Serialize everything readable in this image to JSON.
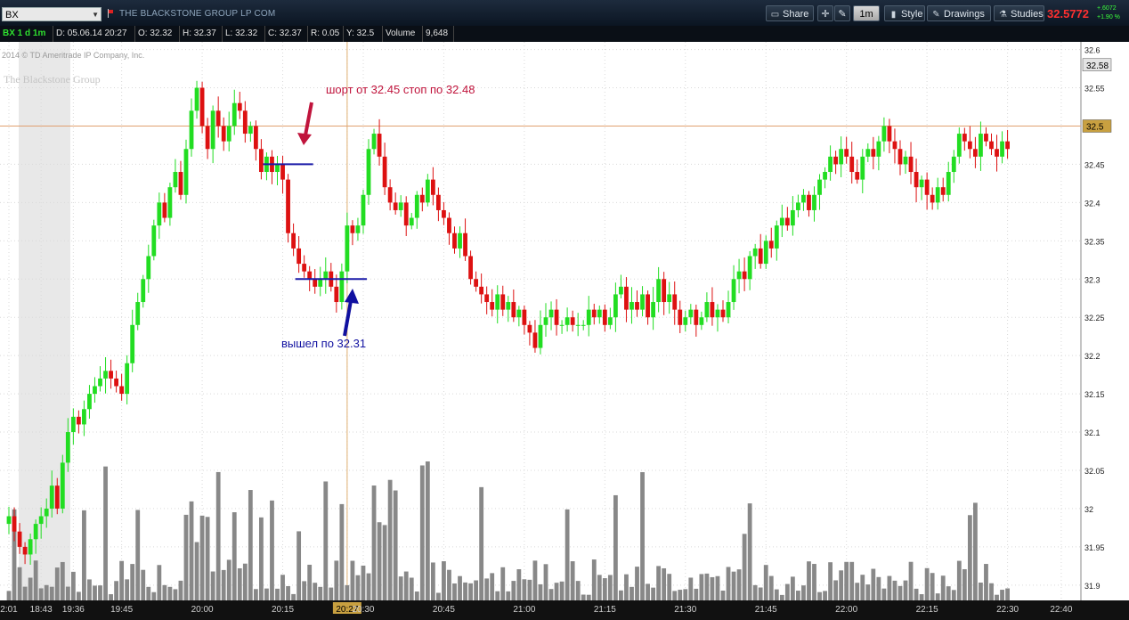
{
  "toolbar": {
    "symbol": "BX",
    "company": "THE BLACKSTONE GROUP LP COM",
    "share_label": "Share",
    "timeframe_label": "1m",
    "style_label": "Style",
    "drawings_label": "Drawings",
    "studies_label": "Studies",
    "last_price": "32.5772",
    "change_abs": "+.6072",
    "change_pct": "+1.90 %",
    "corner_button": "↗"
  },
  "infobar": {
    "title": "BX 1 d 1m",
    "date": "D: 05.06.14 20:27",
    "open": "O: 32.32",
    "high": "H: 32.37",
    "low": "L: 32.32",
    "close": "C: 32.37",
    "range": "R: 0.05",
    "y": "Y: 32.5",
    "volume_label": "Volume",
    "volume_value": "9,648"
  },
  "watermark": {
    "copyright": "2014 © TD Ameritrade IP Company, Inc.",
    "company": "The Blackstone Group"
  },
  "annotations": {
    "short_note": "шорт от 32.45 стоп по 32.48",
    "exit_note": "вышел по 32.31"
  },
  "colors": {
    "up": "#22dd22",
    "down": "#dd1111",
    "volume": "#888888",
    "annotation_red": "#c0143c",
    "annotation_blue": "#1010a0",
    "priceline": "#e0a070"
  },
  "chart_data": {
    "type": "candlestick",
    "symbol": "BX",
    "interval": "1m",
    "ylim": [
      31.88,
      32.61
    ],
    "y_ticks": [
      32.6,
      32.55,
      32.5,
      32.45,
      32.4,
      32.35,
      32.3,
      32.25,
      32.2,
      32.15,
      32.1,
      32.05,
      32.0,
      31.95,
      31.9
    ],
    "x_ticks": [
      {
        "label": "2:01",
        "index": 0
      },
      {
        "label": "18:43",
        "index": 6
      },
      {
        "label": "19:36",
        "index": 12
      },
      {
        "label": "19:45",
        "index": 21
      },
      {
        "label": "20:00",
        "index": 36
      },
      {
        "label": "20:15",
        "index": 51
      },
      {
        "label": "20:27",
        "index": 63,
        "highlight": true
      },
      {
        "label": "20:30",
        "index": 66
      },
      {
        "label": "20:45",
        "index": 81
      },
      {
        "label": "21:00",
        "index": 96
      },
      {
        "label": "21:15",
        "index": 111
      },
      {
        "label": "21:30",
        "index": 126
      },
      {
        "label": "21:45",
        "index": 141
      },
      {
        "label": "22:00",
        "index": 156
      },
      {
        "label": "22:15",
        "index": 171
      },
      {
        "label": "22:30",
        "index": 186
      },
      {
        "label": "22:40",
        "index": 196
      }
    ],
    "price_badges": [
      {
        "label": "32.58",
        "value": 32.58
      },
      {
        "label": "32.5",
        "value": 32.5,
        "highlight": true
      }
    ],
    "price_line": 32.5,
    "crosshair_index": 63,
    "levels": [
      {
        "name": "short-entry",
        "value": 32.45,
        "from": 48,
        "to": 56
      },
      {
        "name": "exit",
        "value": 32.3,
        "from": 54,
        "to": 66
      }
    ],
    "close": [
      31.99,
      31.97,
      31.95,
      31.94,
      31.96,
      31.98,
      31.99,
      32.0,
      32.03,
      32.0,
      32.06,
      32.1,
      32.12,
      32.11,
      32.13,
      32.15,
      32.16,
      32.17,
      32.18,
      32.17,
      32.16,
      32.15,
      32.19,
      32.24,
      32.27,
      32.3,
      32.33,
      32.37,
      32.4,
      32.38,
      32.42,
      32.44,
      32.41,
      32.47,
      32.52,
      32.55,
      32.5,
      32.47,
      32.52,
      32.5,
      32.48,
      32.5,
      32.53,
      32.52,
      32.49,
      32.5,
      32.47,
      32.44,
      32.46,
      32.44,
      32.45,
      32.43,
      32.36,
      32.34,
      32.32,
      32.31,
      32.3,
      32.29,
      32.3,
      32.31,
      32.29,
      32.27,
      32.31,
      32.37,
      32.36,
      32.37,
      32.41,
      32.47,
      32.49,
      32.46,
      32.42,
      32.4,
      32.39,
      32.4,
      32.37,
      32.38,
      32.41,
      32.4,
      32.43,
      32.41,
      32.39,
      32.38,
      32.36,
      32.34,
      32.36,
      32.33,
      32.3,
      32.29,
      32.28,
      32.27,
      32.26,
      32.28,
      32.26,
      32.27,
      32.25,
      32.26,
      32.24,
      32.23,
      32.21,
      32.24,
      32.25,
      32.26,
      32.24,
      32.24,
      32.25,
      32.24,
      32.24,
      32.24,
      32.26,
      32.25,
      32.26,
      32.24,
      32.25,
      32.28,
      32.29,
      32.26,
      32.27,
      32.26,
      32.28,
      32.25,
      32.27,
      32.3,
      32.27,
      32.28,
      32.26,
      32.24,
      32.25,
      32.26,
      32.24,
      32.25,
      32.27,
      32.25,
      32.26,
      32.25,
      32.27,
      32.3,
      32.31,
      32.3,
      32.33,
      32.34,
      32.32,
      32.35,
      32.34,
      32.37,
      32.38,
      32.37,
      32.39,
      32.4,
      32.41,
      32.39,
      32.41,
      32.43,
      32.44,
      32.46,
      32.45,
      32.47,
      32.46,
      32.44,
      32.43,
      32.46,
      32.47,
      32.46,
      32.48,
      32.5,
      32.48,
      32.47,
      32.45,
      32.46,
      32.44,
      32.42,
      32.43,
      32.41,
      32.4,
      32.42,
      32.41,
      32.44,
      32.46,
      32.49,
      32.48,
      32.47,
      32.46,
      32.49,
      32.48,
      32.47,
      32.46,
      32.48,
      32.47
    ]
  }
}
